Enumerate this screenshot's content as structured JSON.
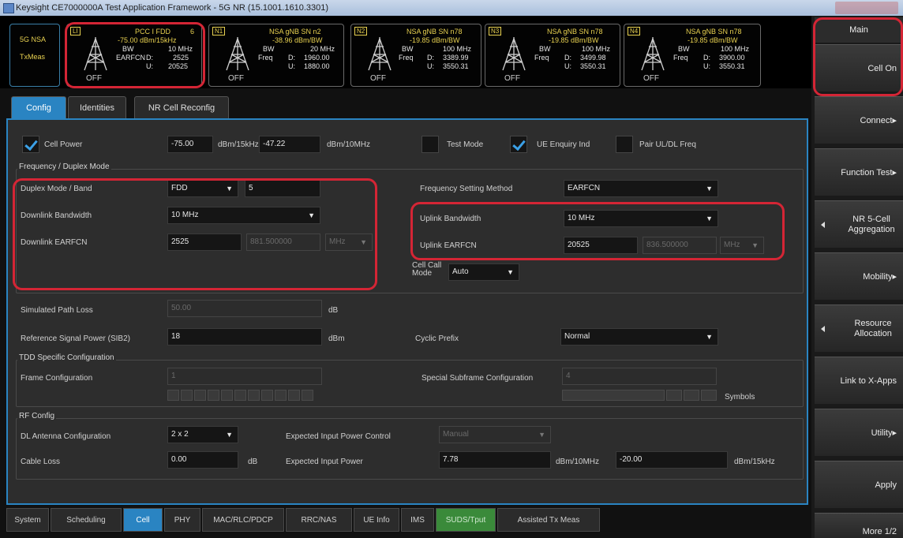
{
  "window": {
    "title": "Keysight CE7000000A Test Application Framework - 5G NR (15.1001.1610.3301)"
  },
  "status": {
    "mode1": "5G NSA",
    "mode2": "TxMeas"
  },
  "cells": [
    {
      "tag": "LI",
      "line1": "PCC I FDD",
      "line1b": "6",
      "line2": "-75.00 dBm/15kHz",
      "k3": "BW",
      "v3": "10 MHz",
      "k4": "EARFCN",
      "d": "D:",
      "v4": "2525",
      "u": "U:",
      "v5": "20525",
      "state": "OFF"
    },
    {
      "tag": "N1",
      "line1": "NSA gNB SN n2",
      "line2": "-38.96 dBm/BW",
      "k3": "BW",
      "v3": "20 MHz",
      "k4": "Freq",
      "d": "D:",
      "v4": "1960.00",
      "u": "U:",
      "v5": "1880.00",
      "state": "OFF"
    },
    {
      "tag": "N2",
      "line1": "NSA gNB SN n78",
      "line2": "-19.85 dBm/BW",
      "k3": "BW",
      "v3": "100 MHz",
      "k4": "Freq",
      "d": "D:",
      "v4": "3389.99",
      "u": "U:",
      "v5": "3550.31",
      "state": "OFF"
    },
    {
      "tag": "N3",
      "line1": "NSA gNB SN n78",
      "line2": "-19.85 dBm/BW",
      "k3": "BW",
      "v3": "100 MHz",
      "k4": "Freq",
      "d": "D:",
      "v4": "3499.98",
      "u": "U:",
      "v5": "3550.31",
      "state": "OFF"
    },
    {
      "tag": "N4",
      "line1": "NSA gNB SN n78",
      "line2": "-19.85 dBm/BW",
      "k3": "BW",
      "v3": "100 MHz",
      "k4": "Freq",
      "d": "D:",
      "v4": "3900.00",
      "u": "U:",
      "v5": "3550.31",
      "state": "OFF"
    }
  ],
  "right_panel": {
    "title": "Main",
    "buttons": [
      {
        "label": "Cell On",
        "arrow": false
      },
      {
        "label": "Connect▸",
        "arrow": false
      },
      {
        "label": "Function Test▸",
        "arrow": false
      },
      {
        "label": "NR 5-Cell Aggregation",
        "arrow": true
      },
      {
        "label": "Mobility▸",
        "arrow": false
      },
      {
        "label": "Resource Allocation",
        "arrow": true
      },
      {
        "label": "Link to X-Apps",
        "arrow": false
      },
      {
        "label": "Utility▸",
        "arrow": false
      },
      {
        "label": "Apply",
        "arrow": false
      },
      {
        "label": "More 1/2",
        "arrow": false
      }
    ]
  },
  "tabs": [
    "Config",
    "Identities",
    "NR Cell Reconfig"
  ],
  "config": {
    "cell_power_label": "Cell Power",
    "cell_power_value": "-75.00",
    "cell_power_unit1": "dBm/15kHz",
    "cell_power_value2": "-47.22",
    "cell_power_unit2": "dBm/10MHz",
    "test_mode_label": "Test Mode",
    "ue_enquiry_label": "UE Enquiry Ind",
    "pair_ul_dl_label": "Pair UL/DL Freq",
    "freq_section": "Frequency / Duplex Mode",
    "duplex_label": "Duplex Mode / Band",
    "duplex_value": "FDD",
    "band_value": "5",
    "dl_bw_label": "Downlink Bandwidth",
    "dl_bw_value": "10 MHz",
    "dl_earfcn_label": "Downlink EARFCN",
    "dl_earfcn_value": "2525",
    "dl_freq_value": "881.500000",
    "dl_freq_unit": "MHz",
    "freq_method_label": "Frequency Setting Method",
    "freq_method_value": "EARFCN",
    "ul_bw_label": "Uplink Bandwidth",
    "ul_bw_value": "10 MHz",
    "ul_earfcn_label": "Uplink EARFCN",
    "ul_earfcn_value": "20525",
    "ul_freq_value": "836.500000",
    "ul_freq_unit": "MHz",
    "cell_call_label": "Cell Call Mode",
    "cell_call_value": "Auto",
    "path_loss_label": "Simulated Path Loss",
    "path_loss_value": "50.00",
    "path_loss_unit": "dB",
    "ref_power_label": "Reference Signal Power (SIB2)",
    "ref_power_value": "18",
    "ref_power_unit": "dBm",
    "cyclic_label": "Cyclic Prefix",
    "cyclic_value": "Normal",
    "tdd_section": "TDD Specific Configuration",
    "frame_label": "Frame Configuration",
    "frame_value": "1",
    "special_label": "Special Subframe Configuration",
    "special_value": "4",
    "symbols_label": "Symbols",
    "rf_section": "RF Config",
    "antenna_label": "DL Antenna Configuration",
    "antenna_value": "2 x 2",
    "cable_label": "Cable Loss",
    "cable_value": "0.00",
    "cable_unit": "dB",
    "exp_ctrl_label": "Expected Input Power Control",
    "exp_ctrl_value": "Manual",
    "exp_power_label": "Expected Input Power",
    "exp_power_value": "7.78",
    "exp_power_unit1": "dBm/10MHz",
    "exp_power_value2": "-20.00",
    "exp_power_unit2": "dBm/15kHz"
  },
  "bottom_tabs": [
    "System",
    "Scheduling",
    "Cell",
    "PHY",
    "MAC/RLC/PDCP",
    "RRC/NAS",
    "UE Info",
    "IMS",
    "SUDS/Tput",
    "Assisted Tx Meas"
  ]
}
